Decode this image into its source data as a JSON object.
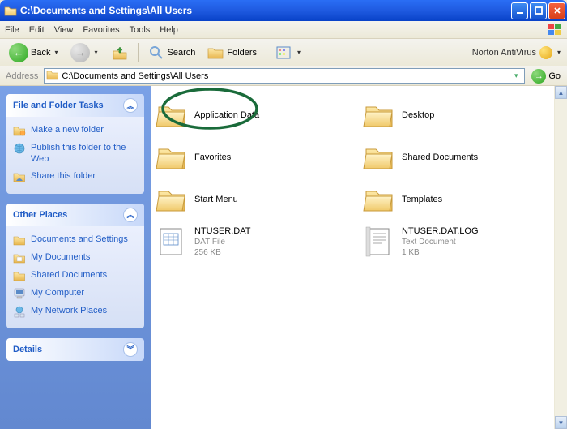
{
  "title": "C:\\Documents and Settings\\All Users",
  "menu": [
    "File",
    "Edit",
    "View",
    "Favorites",
    "Tools",
    "Help"
  ],
  "toolbar": {
    "back": "Back",
    "search": "Search",
    "folders": "Folders"
  },
  "norton": "Norton AntiVirus",
  "address_label": "Address",
  "address_path": "C:\\Documents and Settings\\All Users",
  "go": "Go",
  "sidepanel": {
    "tasks": {
      "title": "File and Folder Tasks",
      "items": [
        "Make a new folder",
        "Publish this folder to the Web",
        "Share this folder"
      ]
    },
    "places": {
      "title": "Other Places",
      "items": [
        "Documents and Settings",
        "My Documents",
        "Shared Documents",
        "My Computer",
        "My Network Places"
      ]
    },
    "details_title": "Details"
  },
  "folders": [
    {
      "name": "Application Data"
    },
    {
      "name": "Desktop"
    },
    {
      "name": "Favorites"
    },
    {
      "name": "Shared Documents"
    },
    {
      "name": "Start Menu"
    },
    {
      "name": "Templates"
    }
  ],
  "files": [
    {
      "name": "NTUSER.DAT",
      "type": "DAT File",
      "size": "256 KB",
      "icon": "dat"
    },
    {
      "name": "NTUSER.DAT.LOG",
      "type": "Text Document",
      "size": "1 KB",
      "icon": "txt"
    }
  ]
}
